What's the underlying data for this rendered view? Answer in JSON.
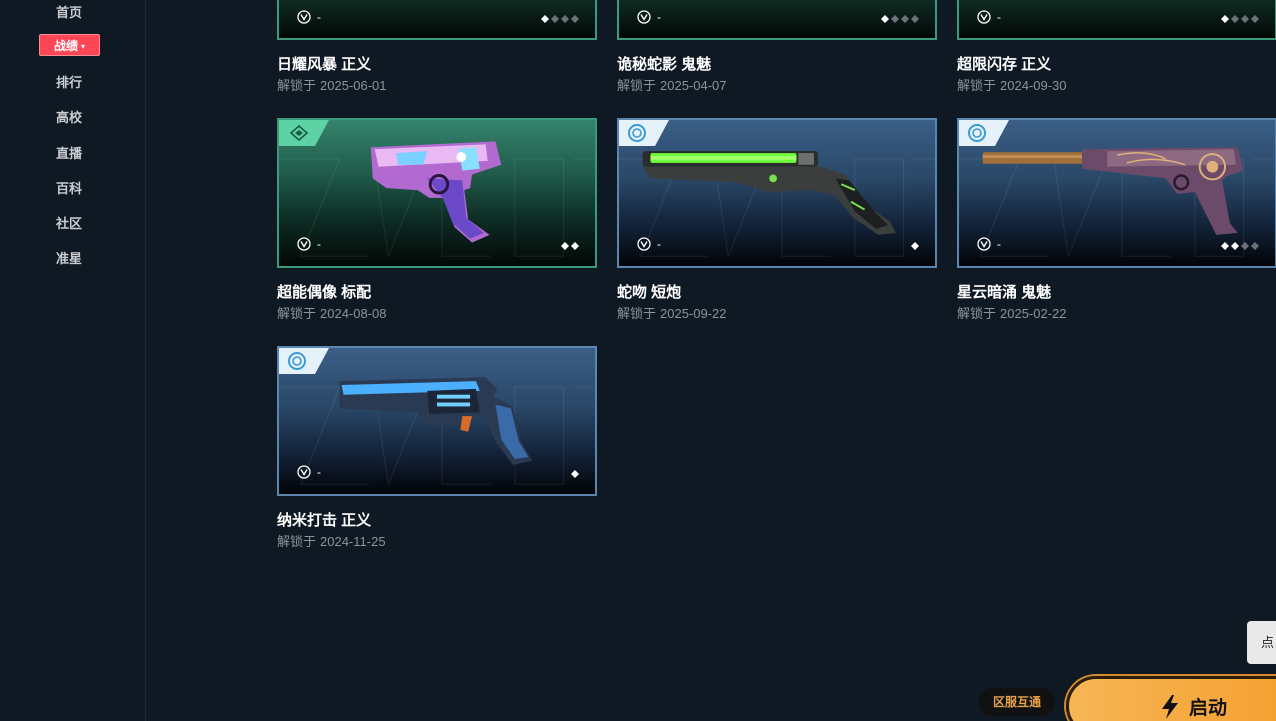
{
  "sidebar": {
    "items": [
      {
        "label": "首页"
      },
      {
        "label": "战绩"
      },
      {
        "label": "排行"
      },
      {
        "label": "高校"
      },
      {
        "label": "直播"
      },
      {
        "label": "百科"
      },
      {
        "label": "社区"
      },
      {
        "label": "准星"
      }
    ],
    "active_caret": "▾"
  },
  "top_row": [
    {
      "title": "日耀风暴 正义",
      "date_prefix": "解锁于",
      "date": "2025-06-01",
      "cost": "-",
      "level": 1,
      "max_level": 4
    },
    {
      "title": "诡秘蛇影 鬼魅",
      "date_prefix": "解锁于",
      "date": "2025-04-07",
      "cost": "-",
      "level": 1,
      "max_level": 4
    },
    {
      "title": "超限闪存 正义",
      "date_prefix": "解锁于",
      "date": "2024-09-30",
      "cost": "-",
      "level": 1,
      "max_level": 4
    }
  ],
  "cards": [
    {
      "title": "超能偶像 标配",
      "date_prefix": "解锁于",
      "date": "2024-08-08",
      "cost": "-",
      "level": 2,
      "max_level": 2,
      "tier": "green"
    },
    {
      "title": "蛇吻 短炮",
      "date_prefix": "解锁于",
      "date": "2025-09-22",
      "cost": "-",
      "level": 1,
      "max_level": 1,
      "tier": "blue"
    },
    {
      "title": "星云暗涌 鬼魅",
      "date_prefix": "解锁于",
      "date": "2025-02-22",
      "cost": "-",
      "level": 2,
      "max_level": 4,
      "tier": "blue"
    },
    {
      "title": "纳米打击 正义",
      "date_prefix": "解锁于",
      "date": "2024-11-25",
      "cost": "-",
      "level": 1,
      "max_level": 1,
      "tier": "blue"
    }
  ],
  "footer": {
    "region_label": "区服互通",
    "launch_label": "启动",
    "side_tip": "点"
  },
  "colors": {
    "background": "#0f1923",
    "active_nav": "#ff4655",
    "green_tier": "#3a9a7b",
    "blue_tier": "#5a86b0",
    "launch": "#f7b656",
    "region_text": "#e6a14a"
  },
  "icons": {
    "cost": "valorant-points-icon",
    "level": "diamond-pip-icon",
    "launch": "lightning-bolt-icon",
    "tier_green": "green-tier-icon",
    "tier_blue": "blue-tier-icon"
  }
}
